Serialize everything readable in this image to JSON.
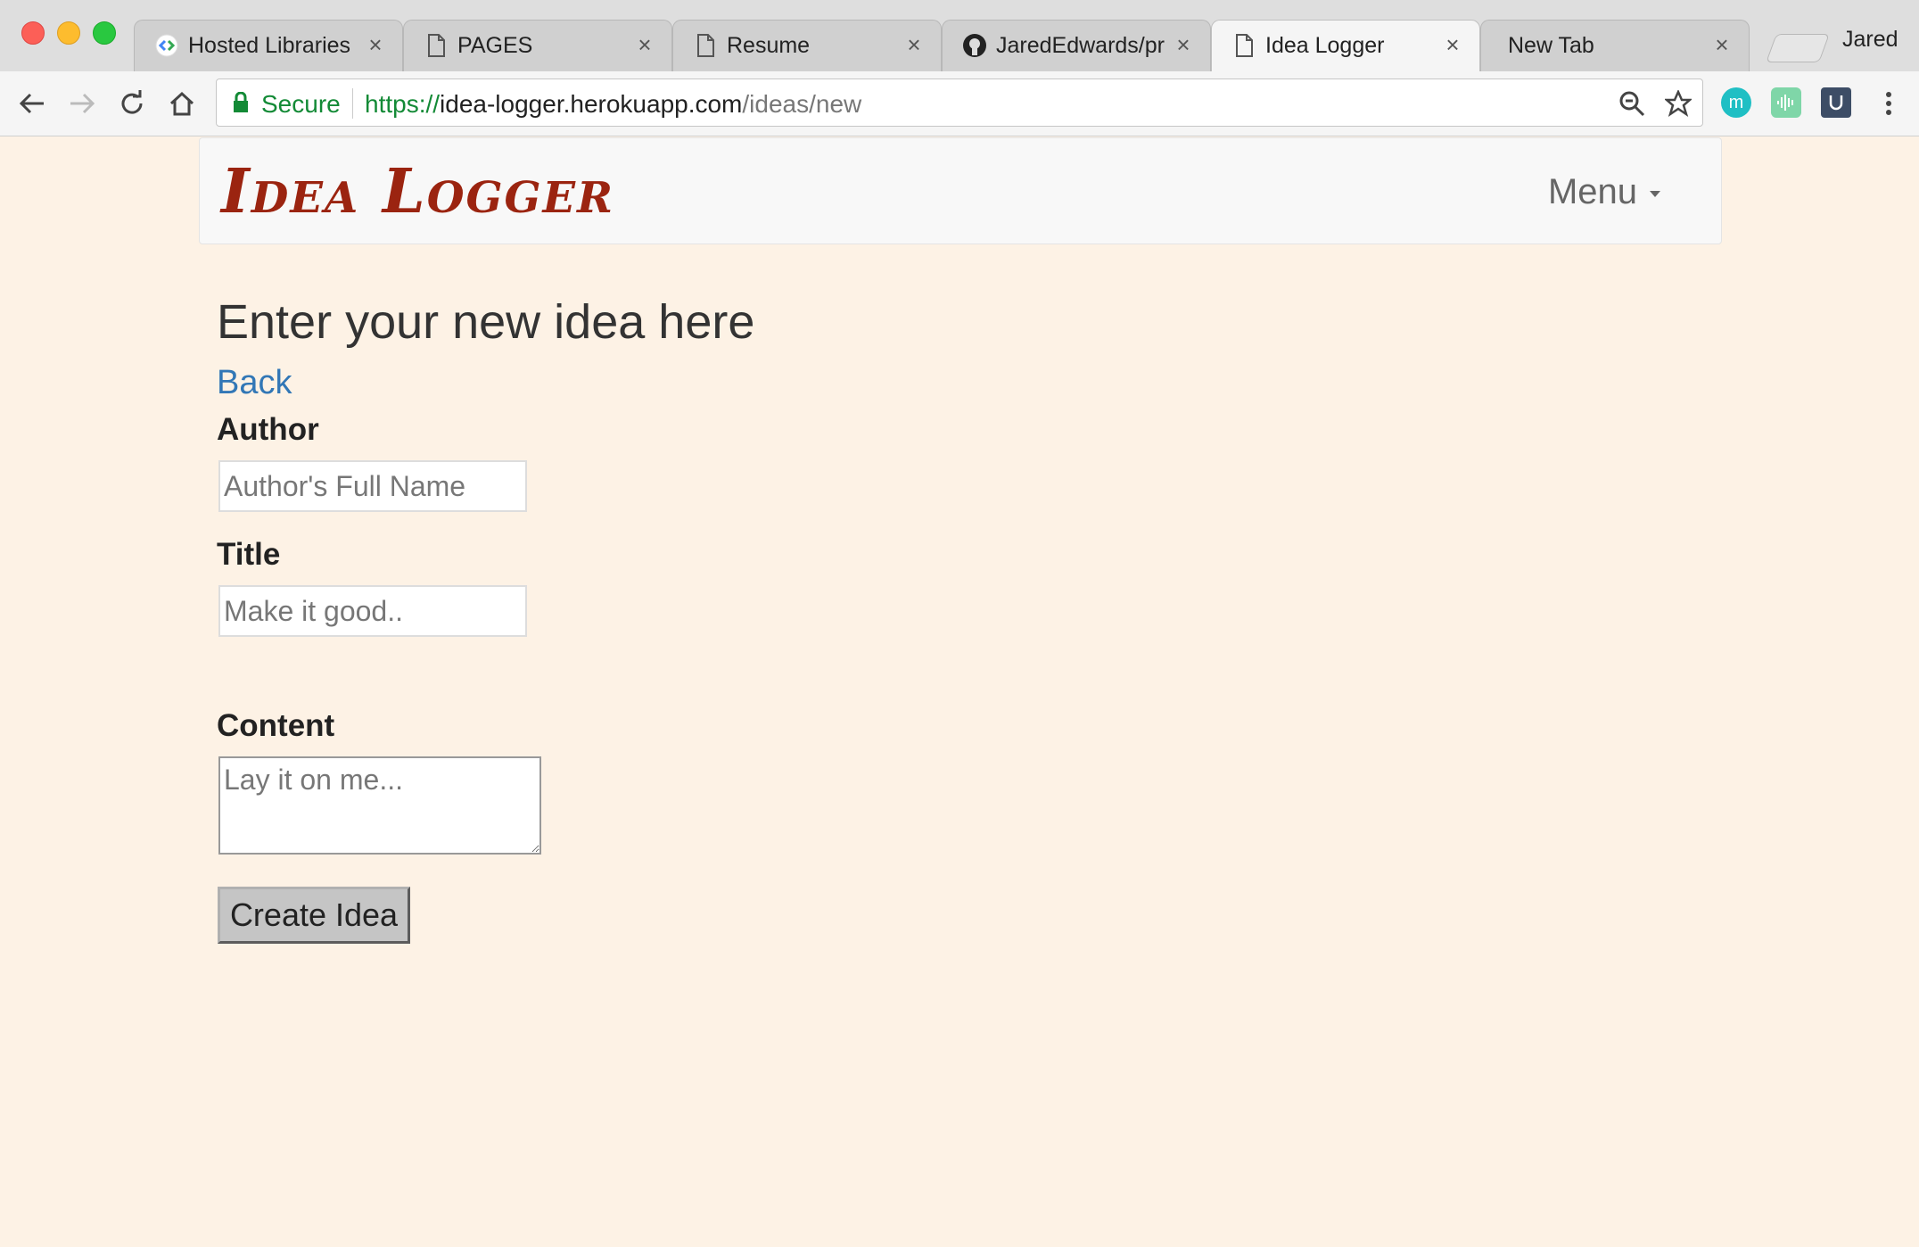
{
  "browser": {
    "tabs": [
      {
        "label": "Hosted Libraries",
        "icon": "google-developers-icon",
        "active": false
      },
      {
        "label": "PAGES",
        "icon": "document-icon",
        "active": false
      },
      {
        "label": "Resume",
        "icon": "document-icon",
        "active": false
      },
      {
        "label": "JaredEdwards/pr",
        "icon": "github-icon",
        "active": false
      },
      {
        "label": "Idea Logger",
        "icon": "document-icon",
        "active": true
      },
      {
        "label": "New Tab",
        "icon": "",
        "active": false
      }
    ],
    "close_glyph": "×",
    "profile_name": "Jared",
    "security_label": "Secure",
    "url": {
      "scheme": "https://",
      "host": "idea-logger.herokuapp.com",
      "path": "/ideas/new"
    },
    "extension_letter": "m"
  },
  "navbar": {
    "brand": "Idea Logger",
    "menu_label": "Menu"
  },
  "page": {
    "heading": "Enter your new idea here",
    "back_link": "Back"
  },
  "form": {
    "author_label": "Author",
    "author_placeholder": "Author's Full Name",
    "title_label": "Title",
    "title_placeholder": "Make it good..",
    "content_label": "Content",
    "content_placeholder": "Lay it on me...",
    "submit_label": "Create Idea"
  },
  "colors": {
    "page_background": "#fdf2e5",
    "brand": "#9b2410",
    "link": "#3277b6",
    "secure": "#138a36"
  }
}
